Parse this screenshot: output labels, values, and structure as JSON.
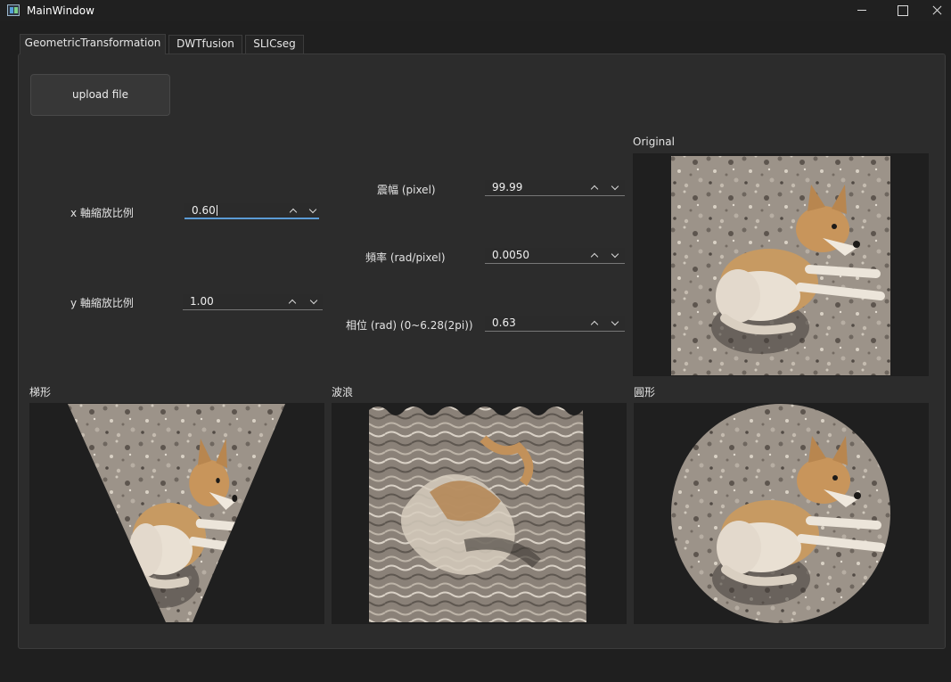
{
  "window": {
    "title": "MainWindow"
  },
  "tabs": [
    {
      "label": "GeometricTransformation",
      "active": true
    },
    {
      "label": "DWTfusion",
      "active": false
    },
    {
      "label": "SLICseg",
      "active": false
    }
  ],
  "upload": {
    "label": "upload file"
  },
  "scale": {
    "x": {
      "label": "x 軸縮放比例",
      "value": "0.60"
    },
    "y": {
      "label": "y 軸縮放比例",
      "value": "1.00"
    }
  },
  "wave": {
    "amplitude": {
      "label": "震幅 (pixel)",
      "value": "99.99"
    },
    "frequency": {
      "label": "頻率 (rad/pixel)",
      "value": "0.0050"
    },
    "phase": {
      "label": "相位 (rad) (0~6.28(2pi))",
      "value": "0.63"
    }
  },
  "images": {
    "original": "Original",
    "trapezoid": "梯形",
    "wave": "波浪",
    "circle": "圓形"
  },
  "colors": {
    "background": "#1f1f1f",
    "panel": "#2c2c2c",
    "accent": "#5b9bd5"
  }
}
